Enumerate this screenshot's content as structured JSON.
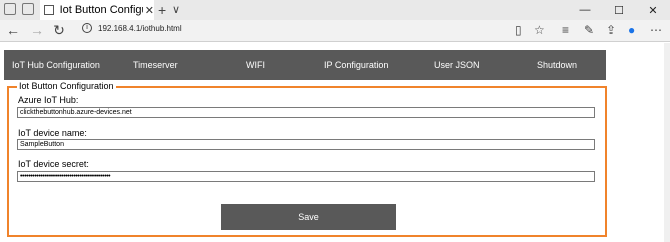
{
  "browser": {
    "tab_title": "Iot Button Configuratior",
    "tab_close": "✕",
    "new_tab": "+",
    "tab_dropdown": "∨",
    "window_min": "—",
    "window_max": "☐",
    "window_close": "✕",
    "url": "192.168.4.1/iothub.html"
  },
  "nav": {
    "items": [
      {
        "label": "IoT Hub Configuration"
      },
      {
        "label": "Timeserver"
      },
      {
        "label": "WIFI"
      },
      {
        "label": "IP Configuration"
      },
      {
        "label": "User JSON"
      },
      {
        "label": "Shutdown"
      }
    ]
  },
  "form": {
    "legend": "Iot Button Configuration",
    "hub_label": "Azure IoT Hub:",
    "hub_value": "clickthebuttonhub.azure-devices.net",
    "device_name_label": "IoT device name:",
    "device_name_value": "SampleButton",
    "device_secret_label": "IoT device secret:",
    "device_secret_value": "••••••••••••••••••••••••••••••••••••••••••••",
    "save_label": "Save"
  },
  "colors": {
    "accent": "#f0832b",
    "nav_bg": "#595959"
  }
}
